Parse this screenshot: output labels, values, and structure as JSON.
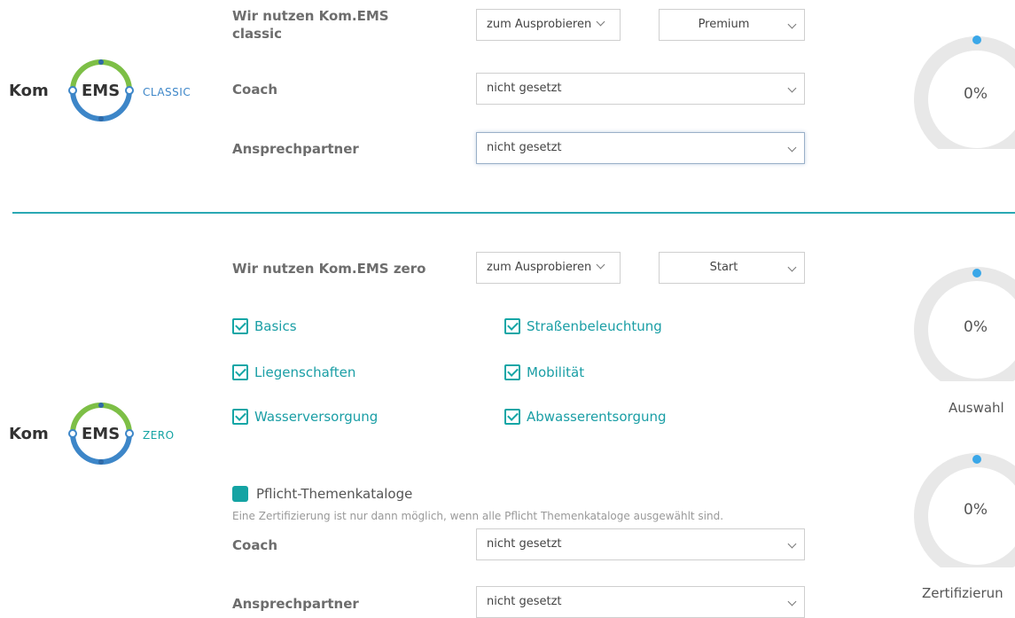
{
  "classic": {
    "logo": {
      "kom": "Kom",
      "ems": "EMS",
      "variant": "CLASSIC"
    },
    "usage_label": "Wir nutzen Kom.EMS classic",
    "usage_select": "zum Ausprobieren",
    "tier_select": "Premium",
    "coach_label": "Coach",
    "coach_select": "nicht gesetzt",
    "contact_label": "Ansprechpartner",
    "contact_select": "nicht gesetzt",
    "progress": {
      "percent_text": "0%",
      "value": 0
    }
  },
  "zero": {
    "logo": {
      "kom": "Kom",
      "ems": "EMS",
      "variant": "ZERO"
    },
    "usage_label": "Wir nutzen Kom.EMS zero",
    "usage_select": "zum Ausprobieren",
    "tier_select": "Start",
    "catalogs": [
      {
        "label": "Basics",
        "checked": true
      },
      {
        "label": "Straßenbeleuchtung",
        "checked": true
      },
      {
        "label": "Liegenschaften",
        "checked": true
      },
      {
        "label": "Mobilität",
        "checked": true
      },
      {
        "label": "Wasserversorgung",
        "checked": true
      },
      {
        "label": "Abwasserentsorgung",
        "checked": true
      }
    ],
    "legend_label": "Pflicht-Themenkataloge",
    "note": "Eine Zertifizierung ist nur dann möglich, wenn alle Pflicht Themenkataloge ausgewählt sind.",
    "coach_label": "Coach",
    "coach_select": "nicht gesetzt",
    "contact_label": "Ansprechpartner",
    "contact_select": "nicht gesetzt",
    "selection_progress": {
      "percent_text": "0%",
      "caption": "Auswahl",
      "value": 0
    },
    "certification_progress": {
      "percent_text": "0%",
      "caption": "Zertifizierun",
      "value": 0
    }
  },
  "colors": {
    "accent": "#14a6a6",
    "divider": "#2aa8b3",
    "donut_track": "#e8e8e8",
    "donut_marker": "#3aa7e8",
    "logo_ring_green": "#7dbf46",
    "logo_ring_blue": "#3d86c8"
  }
}
